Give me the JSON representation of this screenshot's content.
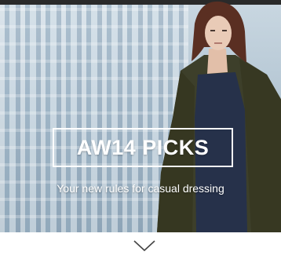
{
  "hero": {
    "headline": "AW14 PICKS",
    "subtitle": "Your new rules for casual dressing"
  },
  "icons": {
    "scroll": "chevron-down-icon"
  },
  "colors": {
    "coat": "#3d3f2a",
    "dress": "#26314a",
    "hair": "#5a2f22",
    "skin": "#e9cbb7",
    "sky": "#b4c6d3"
  }
}
